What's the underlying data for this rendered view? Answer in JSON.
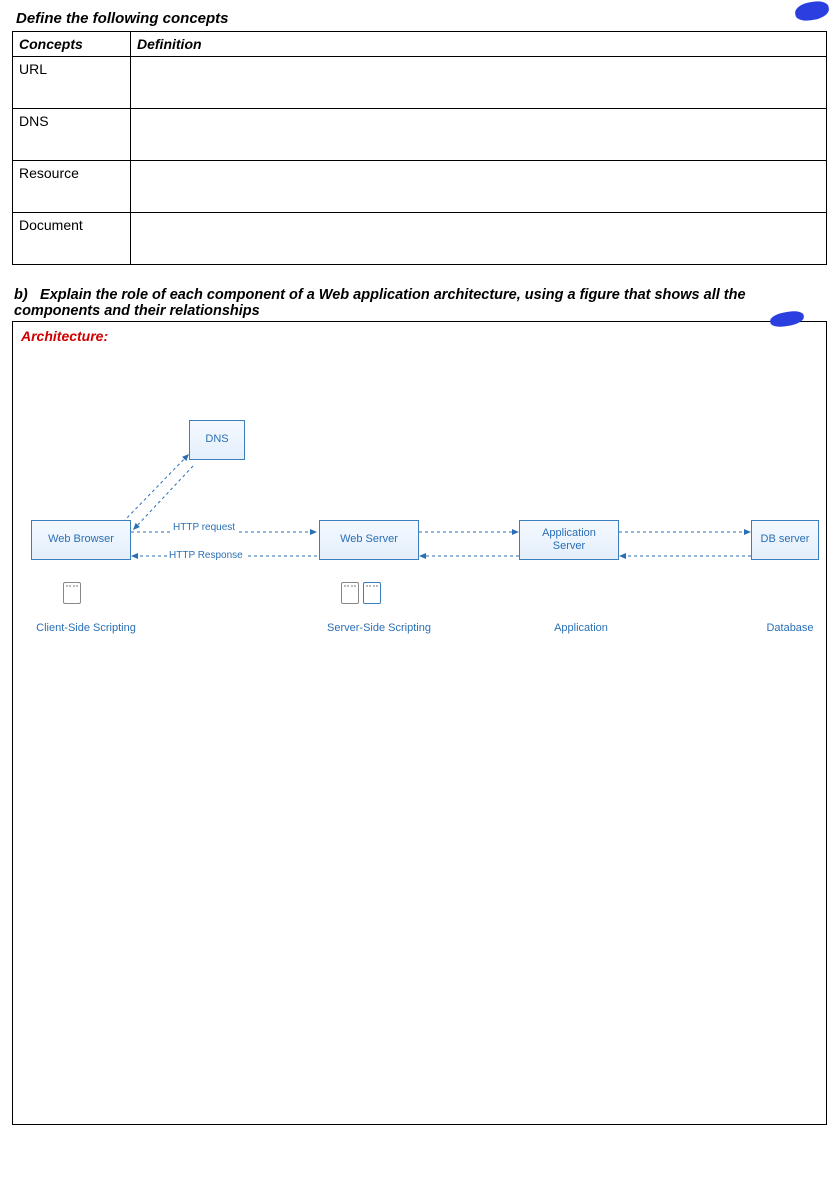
{
  "heading_a": "Define the following concepts",
  "table": {
    "header_concepts": "Concepts",
    "header_definition": "Definition",
    "rows": [
      {
        "concept": "URL",
        "definition": ""
      },
      {
        "concept": "DNS",
        "definition": ""
      },
      {
        "concept": "Resource",
        "definition": ""
      },
      {
        "concept": "Document",
        "definition": ""
      }
    ]
  },
  "question_b": {
    "label": "b)",
    "text": "Explain the role of each component of a Web application architecture, using a figure that shows all the components and their relationships"
  },
  "architecture_title": "Architecture:",
  "diagram": {
    "nodes": {
      "dns": "DNS",
      "web_browser": "Web Browser",
      "web_server": "Web Server",
      "app_server": "Application\nServer",
      "db_server": "DB server"
    },
    "links": {
      "http_request": "HTTP request",
      "http_response": "HTTP Response"
    },
    "captions": {
      "client_side": "Client-Side Scripting",
      "server_side": "Server-Side Scripting",
      "application": "Application",
      "database": "Database"
    }
  }
}
